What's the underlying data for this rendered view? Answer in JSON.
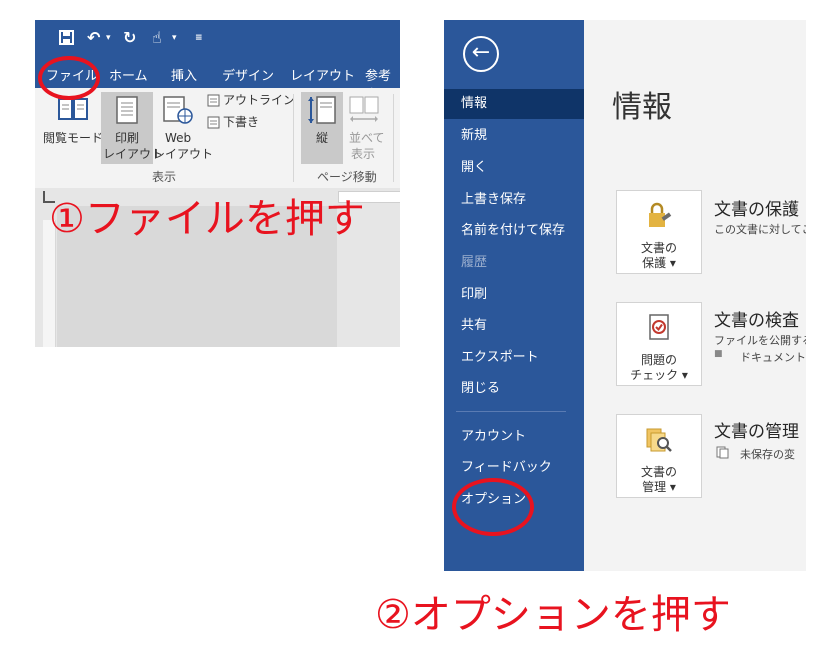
{
  "ribbon": {
    "tabs": [
      "ファイル",
      "ホーム",
      "挿入",
      "デザイン",
      "レイアウト",
      "参考資"
    ],
    "view_group": {
      "read_mode": "閲覧モード",
      "print_layout": [
        "印刷",
        "レイアウト"
      ],
      "web_layout": [
        "Web",
        "レイアウト"
      ],
      "outline": "アウトライン",
      "draft": "下書き",
      "label": "表示"
    },
    "page_move_group": {
      "vertical": "縦",
      "side_by_side": [
        "並べて",
        "表示"
      ],
      "label": "ページ移動"
    }
  },
  "backstage": {
    "title": "情報",
    "nav_items": [
      "情報",
      "新規",
      "開く",
      "上書き保存",
      "名前を付けて保存",
      "履歴",
      "印刷",
      "共有",
      "エクスポート",
      "閉じる"
    ],
    "nav_bottom": [
      "アカウント",
      "フィードバック",
      "オプション"
    ],
    "sections": [
      {
        "button": [
          "文書の",
          "保護 ▾"
        ],
        "title": "文書の保護",
        "desc": "この文書に対してこ"
      },
      {
        "button": [
          "問題の",
          "チェック ▾"
        ],
        "title": "文書の検査",
        "desc": "ファイルを公開する",
        "bullet": "ドキュメントの"
      },
      {
        "button": [
          "文書の",
          "管理 ▾"
        ],
        "title": "文書の管理",
        "desc": "未保存の変"
      }
    ]
  },
  "annotations": {
    "step1": "①ファイルを押す",
    "step2": "②オプションを押す"
  },
  "colors": {
    "word_blue": "#2b579a",
    "selected_nav": "#0f3468",
    "annotation_red": "#e8131f"
  }
}
